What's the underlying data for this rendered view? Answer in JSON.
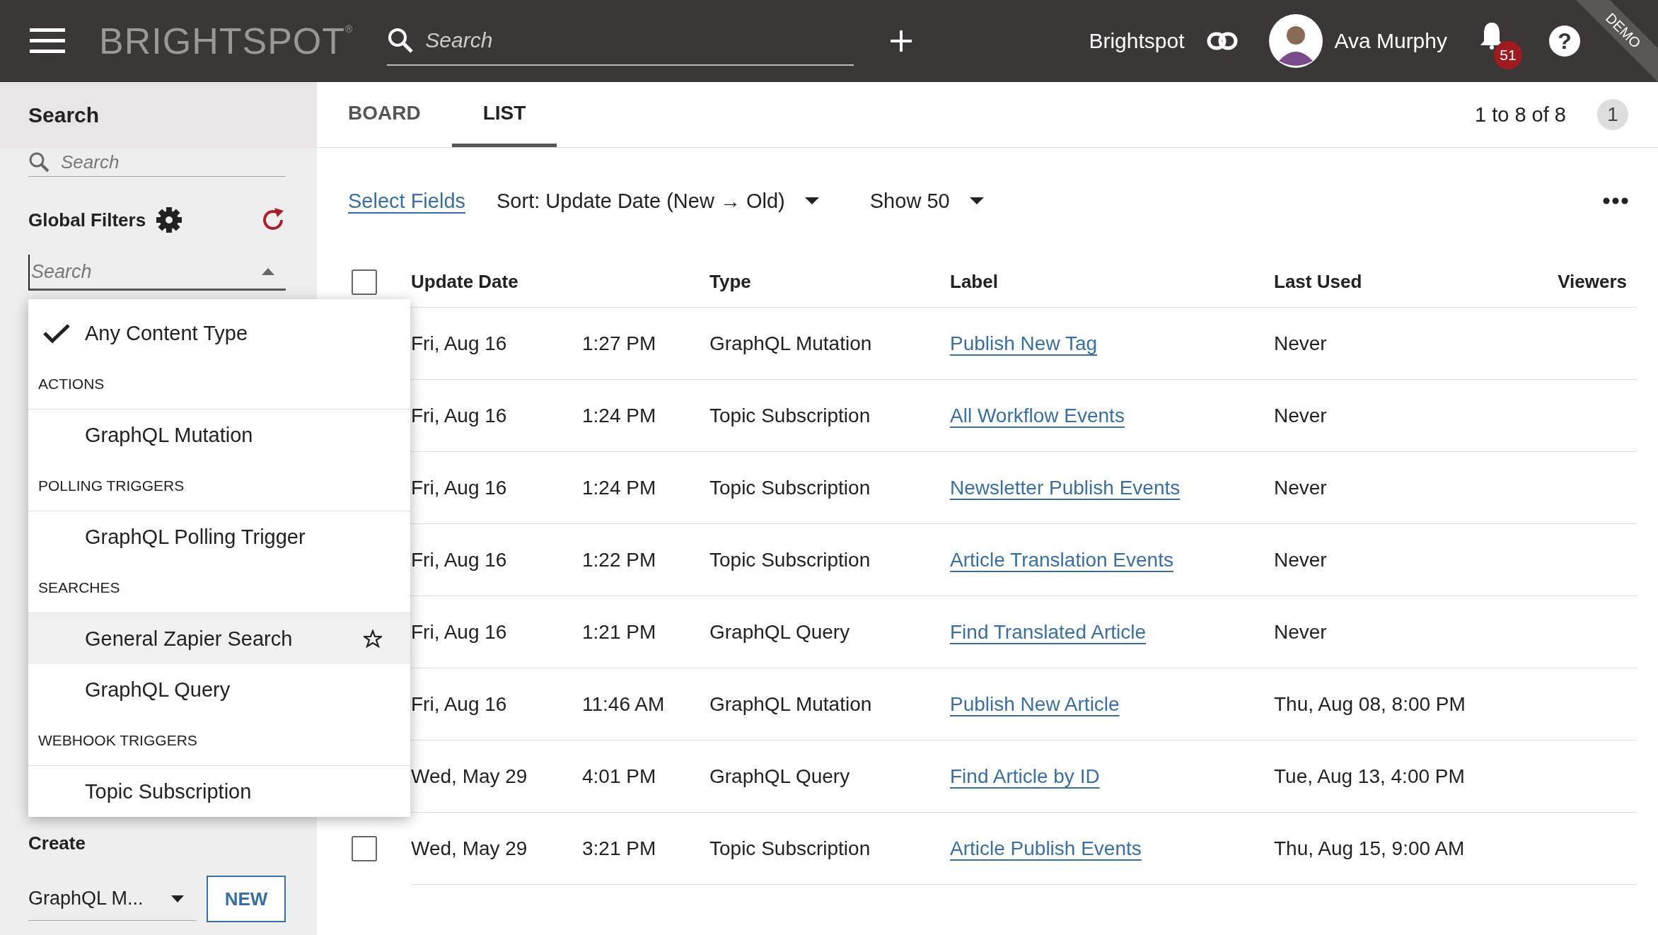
{
  "header": {
    "logo": "BRIGHTSPOT",
    "logo_mark": "®",
    "search": {
      "placeholder": "Search"
    },
    "site": "Brightspot",
    "user": "Ava Murphy",
    "notifications": "51",
    "help": "?",
    "ribbon": "DEMO"
  },
  "sidebar": {
    "title": "Search",
    "search": {
      "placeholder": "Search"
    },
    "global_filters": "Global Filters",
    "type_filter": {
      "placeholder": "Search",
      "expanded": true,
      "options": [
        {
          "kind": "option",
          "label": "Any Content Type",
          "selected": true,
          "highlighted": false
        },
        {
          "kind": "heading",
          "label": "ACTIONS"
        },
        {
          "kind": "option",
          "label": "GraphQL Mutation",
          "selected": false,
          "highlighted": false
        },
        {
          "kind": "heading",
          "label": "POLLING TRIGGERS"
        },
        {
          "kind": "option",
          "label": "GraphQL Polling Trigger",
          "selected": false,
          "highlighted": false
        },
        {
          "kind": "heading",
          "label": "SEARCHES"
        },
        {
          "kind": "option",
          "label": "General Zapier Search",
          "selected": false,
          "highlighted": true
        },
        {
          "kind": "option",
          "label": "GraphQL Query",
          "selected": false,
          "highlighted": false
        },
        {
          "kind": "heading",
          "label": "WEBHOOK TRIGGERS"
        },
        {
          "kind": "option",
          "label": "Topic Subscription",
          "selected": false,
          "highlighted": false
        }
      ]
    },
    "create": {
      "title": "Create",
      "select": "GraphQL M...",
      "button": "NEW"
    }
  },
  "tabs": [
    {
      "label": "BOARD",
      "selected": false
    },
    {
      "label": "LIST",
      "selected": true
    }
  ],
  "pagination": {
    "range": "1 to 8 of 8",
    "page": "1"
  },
  "toolbar": {
    "select_fields": "Select Fields",
    "sort": "Sort: Update Date (New → Old)",
    "show": "Show 50"
  },
  "table": {
    "columns": [
      "Update Date",
      "Type",
      "Label",
      "Last Used",
      "Viewers"
    ],
    "select_all_checked": false,
    "rows": [
      {
        "date": "Fri, Aug 16",
        "time": "1:27 PM",
        "type": "GraphQL Mutation",
        "label": "Publish New Tag",
        "last_used": "Never"
      },
      {
        "date": "Fri, Aug 16",
        "time": "1:24 PM",
        "type": "Topic Subscription",
        "label": "All Workflow Events",
        "last_used": "Never"
      },
      {
        "date": "Fri, Aug 16",
        "time": "1:24 PM",
        "type": "Topic Subscription",
        "label": "Newsletter Publish Events",
        "last_used": "Never"
      },
      {
        "date": "Fri, Aug 16",
        "time": "1:22 PM",
        "type": "Topic Subscription",
        "label": "Article Translation Events",
        "last_used": "Never"
      },
      {
        "date": "Fri, Aug 16",
        "time": "1:21 PM",
        "type": "GraphQL Query",
        "label": "Find Translated Article",
        "last_used": "Never"
      },
      {
        "date": "Fri, Aug 16",
        "time": "11:46 AM",
        "type": "GraphQL Mutation",
        "label": "Publish New Article",
        "last_used": "Thu, Aug 08, 8:00 PM"
      },
      {
        "date": "Wed, May 29",
        "time": "4:01 PM",
        "type": "GraphQL Query",
        "label": "Find Article by ID",
        "last_used": "Tue, Aug 13, 4:00 PM"
      },
      {
        "date": "Wed, May 29",
        "time": "3:21 PM",
        "type": "Topic Subscription",
        "label": "Article Publish Events",
        "last_used": "Thu, Aug 15, 9:00 AM",
        "checked": false
      }
    ]
  }
}
